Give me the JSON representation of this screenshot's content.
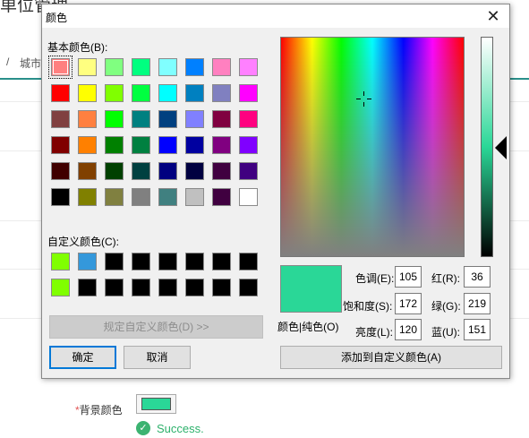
{
  "background": {
    "title": "单位管理",
    "breadcrumb_sep": "/",
    "breadcrumb": "城市",
    "field_required_mark": "*",
    "field_label": "背景颜色",
    "success_text": "Success."
  },
  "dialog": {
    "title": "颜色",
    "close_glyph": "✕",
    "basic_colors_label": "基本颜色(B):",
    "custom_colors_label": "自定义颜色(C):",
    "define_custom_button": "规定自定义颜色(D) >>",
    "ok_button": "确定",
    "cancel_button": "取消",
    "add_custom_button": "添加到自定义颜色(A)",
    "color_solid_label": "颜色|纯色(O)",
    "hue_label": "色调(E):",
    "sat_label": "饱和度(S):",
    "lum_label": "亮度(L):",
    "red_label": "红(R):",
    "green_label": "绿(G):",
    "blue_label": "蓝(U):",
    "hue": "105",
    "sat": "172",
    "lum": "120",
    "red": "36",
    "green": "219",
    "blue": "151",
    "current_color": "#2ad797",
    "basic_colors": [
      "#ff8080",
      "#ffff80",
      "#80ff80",
      "#00ff80",
      "#80ffff",
      "#0080ff",
      "#ff80c0",
      "#ff80ff",
      "#ff0000",
      "#ffff00",
      "#80ff00",
      "#00ff40",
      "#00ffff",
      "#0080c0",
      "#8080c0",
      "#ff00ff",
      "#804040",
      "#ff8040",
      "#00ff00",
      "#008080",
      "#004080",
      "#8080ff",
      "#800040",
      "#ff0080",
      "#800000",
      "#ff8000",
      "#008000",
      "#008040",
      "#0000ff",
      "#0000a0",
      "#800080",
      "#8000ff",
      "#400000",
      "#804000",
      "#004000",
      "#004040",
      "#000080",
      "#000040",
      "#400040",
      "#400080",
      "#000000",
      "#808000",
      "#808040",
      "#808080",
      "#408080",
      "#c0c0c0",
      "#400040",
      "#ffffff"
    ],
    "selected_basic_index": 0,
    "custom_colors": [
      "#80ff00",
      "#3498db",
      "#000000",
      "#000000",
      "#000000",
      "#000000",
      "#000000",
      "#000000",
      "#80ff00",
      "#000000",
      "#000000",
      "#000000",
      "#000000",
      "#000000",
      "#000000",
      "#000000"
    ]
  }
}
